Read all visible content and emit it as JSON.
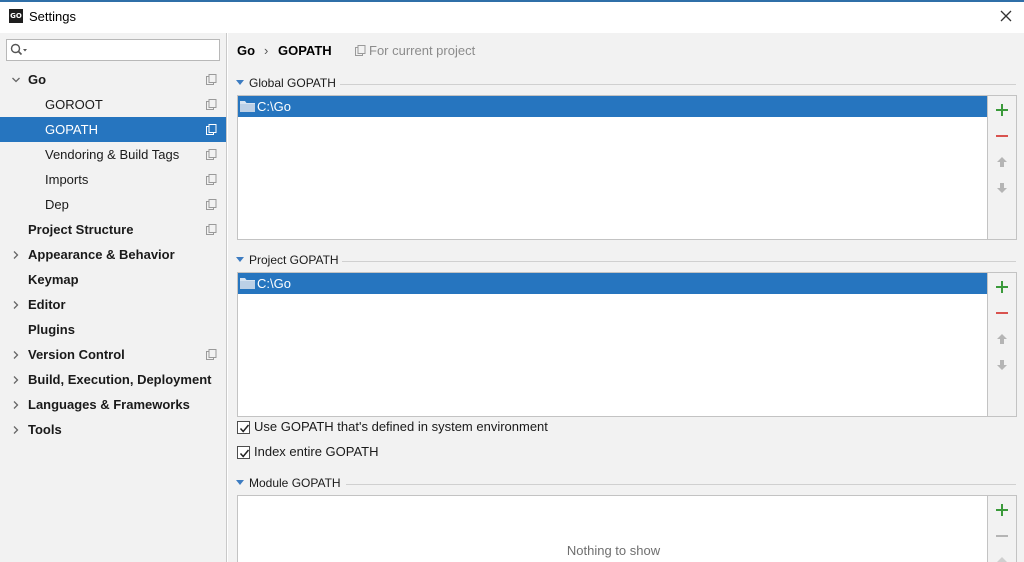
{
  "window": {
    "title": "Settings",
    "app_icon_text": "GO"
  },
  "search": {
    "value": "",
    "placeholder": ""
  },
  "sidebar": {
    "items": [
      {
        "label": "Go",
        "level": 0,
        "expandable": true,
        "expanded": true,
        "bold": true,
        "project_icon": true,
        "selected": false
      },
      {
        "label": "GOROOT",
        "level": 1,
        "expandable": false,
        "bold": false,
        "project_icon": true,
        "selected": false
      },
      {
        "label": "GOPATH",
        "level": 1,
        "expandable": false,
        "bold": false,
        "project_icon": true,
        "selected": true
      },
      {
        "label": "Vendoring & Build Tags",
        "level": 1,
        "expandable": false,
        "bold": false,
        "project_icon": true,
        "selected": false
      },
      {
        "label": "Imports",
        "level": 1,
        "expandable": false,
        "bold": false,
        "project_icon": true,
        "selected": false
      },
      {
        "label": "Dep",
        "level": 1,
        "expandable": false,
        "bold": false,
        "project_icon": true,
        "selected": false
      },
      {
        "label": "Project Structure",
        "level": 0,
        "expandable": false,
        "bold": true,
        "project_icon": true,
        "selected": false
      },
      {
        "label": "Appearance & Behavior",
        "level": 0,
        "expandable": true,
        "expanded": false,
        "bold": true,
        "project_icon": false,
        "selected": false
      },
      {
        "label": "Keymap",
        "level": 0,
        "expandable": false,
        "bold": true,
        "project_icon": false,
        "selected": false
      },
      {
        "label": "Editor",
        "level": 0,
        "expandable": true,
        "expanded": false,
        "bold": true,
        "project_icon": false,
        "selected": false
      },
      {
        "label": "Plugins",
        "level": 0,
        "expandable": false,
        "bold": true,
        "project_icon": false,
        "selected": false
      },
      {
        "label": "Version Control",
        "level": 0,
        "expandable": true,
        "expanded": false,
        "bold": true,
        "project_icon": true,
        "selected": false
      },
      {
        "label": "Build, Execution, Deployment",
        "level": 0,
        "expandable": true,
        "expanded": false,
        "bold": true,
        "project_icon": false,
        "selected": false
      },
      {
        "label": "Languages & Frameworks",
        "level": 0,
        "expandable": true,
        "expanded": false,
        "bold": true,
        "project_icon": false,
        "selected": false
      },
      {
        "label": "Tools",
        "level": 0,
        "expandable": true,
        "expanded": false,
        "bold": true,
        "project_icon": false,
        "selected": false
      }
    ]
  },
  "breadcrumb": {
    "parent": "Go",
    "separator": "›",
    "current": "GOPATH",
    "scope": "For current project"
  },
  "sections": {
    "global": {
      "title": "Global GOPATH",
      "entries": [
        "C:\\Go"
      ]
    },
    "project": {
      "title": "Project GOPATH",
      "entries": [
        "C:\\Go"
      ]
    },
    "module": {
      "title": "Module GOPATH",
      "entries": [],
      "empty_text": "Nothing to show"
    }
  },
  "options": {
    "use_system_gopath": {
      "label": "Use GOPATH that's defined in system environment",
      "checked": true
    },
    "index_entire_gopath": {
      "label": "Index entire GOPATH",
      "checked": true
    }
  },
  "colors": {
    "selection": "#2675bf",
    "add_green": "#3b9a3b",
    "remove_red": "#d9534f",
    "arrow_gray": "#b5b5b5",
    "section_triangle": "#3d7cc1"
  },
  "icons": {
    "add": "plus-icon",
    "remove": "minus-icon",
    "up": "arrow-up-icon",
    "down": "arrow-down-icon",
    "folder": "folder-icon",
    "project": "project-scope-icon"
  }
}
